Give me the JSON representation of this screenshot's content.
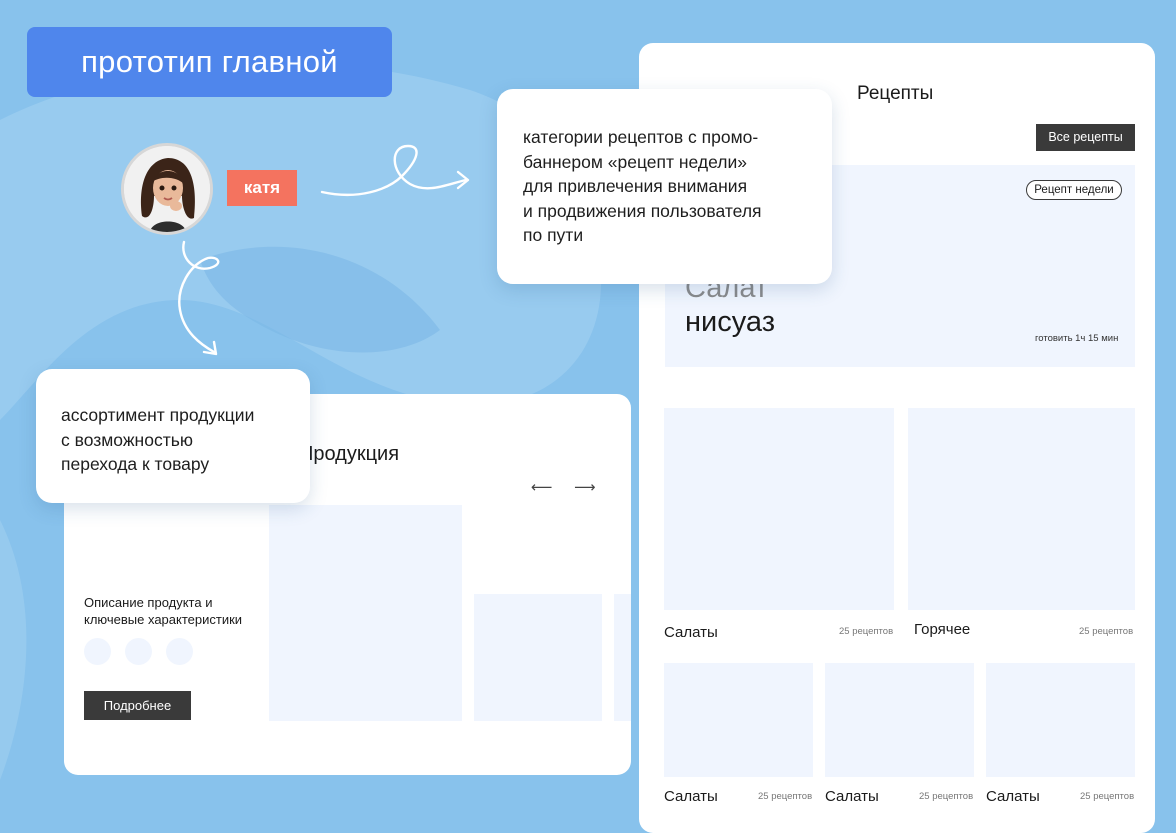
{
  "header": {
    "title": "прототип главной"
  },
  "user": {
    "name": "катя"
  },
  "notes": {
    "recipes_note_lines": [
      "категории рецептов с промо-",
      "баннером «рецепт недели»",
      "для привлечения внимания",
      "и продвижения пользователя",
      "по пути"
    ],
    "products_note_lines": [
      "ассортимент продукции",
      "с возможностью",
      "перехода к товару"
    ]
  },
  "recipes": {
    "title": "Рецепты",
    "all_button": "Все рецепты",
    "banner": {
      "badge": "Рецепт недели",
      "title_line_1": "Салат",
      "title_line_2": "нисуаз",
      "cook_time": "готовить 1ч 15 мин"
    },
    "categories": [
      {
        "name": "Салаты",
        "count": "25 рецептов"
      },
      {
        "name": "Горячее",
        "count": "25 рецептов"
      },
      {
        "name": "Салаты",
        "count": "25 рецептов"
      },
      {
        "name": "Салаты",
        "count": "25 рецептов"
      },
      {
        "name": "Салаты",
        "count": "25 рецептов"
      }
    ]
  },
  "products": {
    "title": "Продукция",
    "prev_arrow": "⟵",
    "next_arrow": "⟶",
    "description_lines": [
      "Описание продукта и",
      "ключевые характеристики"
    ],
    "more_button": "Подробнее"
  },
  "colors": {
    "background": "#88c2ec",
    "title_badge": "#4f86ec",
    "name_tag": "#f4735f",
    "placeholder": "#f0f5fe",
    "dark_button": "#3a3a3a"
  }
}
